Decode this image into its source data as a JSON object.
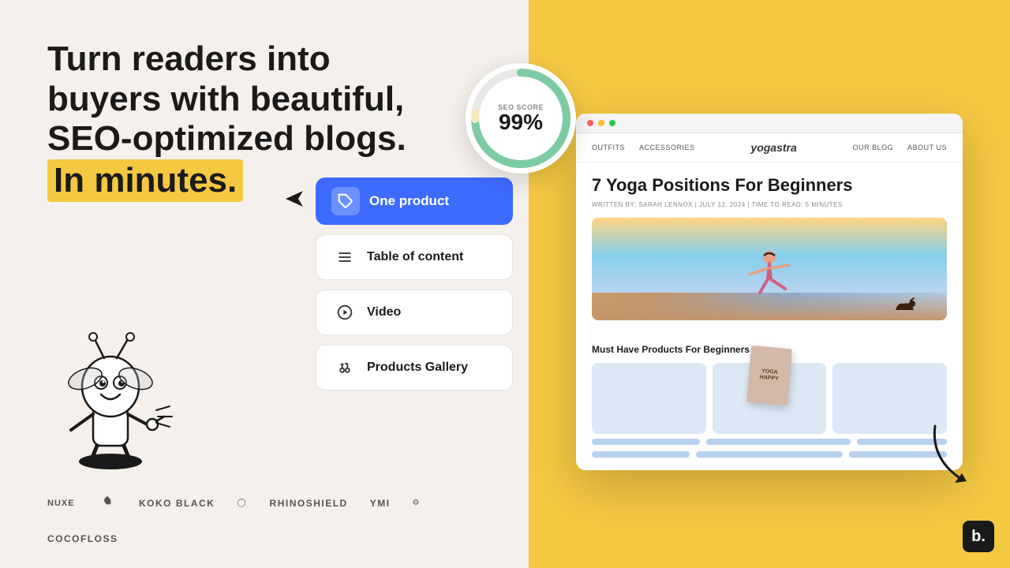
{
  "left": {
    "headline_line1": "Turn readers into",
    "headline_line2": "buyers with beautiful,",
    "headline_line3": "SEO-optimized blogs.",
    "highlight_text": "In minutes.",
    "feature_cards": [
      {
        "id": "one-product",
        "label": "One product",
        "icon": "tag",
        "selected": true
      },
      {
        "id": "table-of-content",
        "label": "Table of content",
        "icon": "list",
        "selected": false
      },
      {
        "id": "video",
        "label": "Video",
        "icon": "play-circle",
        "selected": false
      },
      {
        "id": "products-gallery",
        "label": "Products Gallery",
        "icon": "grid",
        "selected": false
      }
    ],
    "brands": [
      "NUXE",
      "KOKO BLACK",
      "RHINOSHIELD",
      "YMI",
      "COCOFLOSS"
    ]
  },
  "right": {
    "seo": {
      "label": "SEO SCORE",
      "value": "99%"
    },
    "nav": {
      "logo": "yogastra",
      "links": [
        "OUTFITS",
        "ACCESSORIES",
        "OUR BLOG",
        "ABOUT US"
      ]
    },
    "blog": {
      "title": "7 Yoga Positions For Beginners",
      "meta": "WRITTEN BY: SARAH LENNOX  |  JULY 12, 2024  |  TIME TO READ: 5 MINUTES"
    },
    "products_section": {
      "title": "Must Have Products For Beginners",
      "book_title_line1": "YOGA",
      "book_title_line2": "HAPPY"
    }
  },
  "b_logo": "b."
}
